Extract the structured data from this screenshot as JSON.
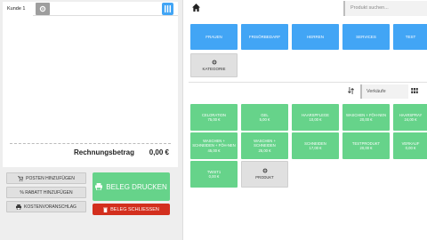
{
  "tabs": {
    "active": "Kunde 1"
  },
  "receipt": {
    "total_label": "Rechnungsbetrag",
    "total_value": "0,00 €"
  },
  "actions": {
    "add_item": "POSTEN HINZUFÜGEN",
    "add_discount": "% RABATT HINZUFÜGEN",
    "estimate": "KOSTENVORANSCHLAG",
    "print": "BELEG DRUCKEN",
    "close": "BELEG SCHLIESSEN"
  },
  "search": {
    "placeholder": "Produkt suchen..."
  },
  "categories": [
    "FRAUEN",
    "FRISÖRBEDARF",
    "HERREN",
    "SERVICES",
    "TEST"
  ],
  "category_button": "KATEGORIE",
  "sort": {
    "selected": "Verkäufe"
  },
  "products": [
    {
      "name": "CELORATION",
      "price": "75,00 €"
    },
    {
      "name": "GEL",
      "price": "5,00 €"
    },
    {
      "name": "HAARSPFLEGE",
      "price": "10,00 €"
    },
    {
      "name": "WASCHEN + FÖH-NEN",
      "price": "20,00 €"
    },
    {
      "name": "HAARSPRAY",
      "price": "24,00 €"
    },
    {
      "name": "WASCHEN + SCHNEIDEN + FÖH-NEN",
      "price": "45,00 €"
    },
    {
      "name": "WASCHEN + SCHNEIDEN",
      "price": "25,00 €"
    },
    {
      "name": "SCHNEIDEN",
      "price": "17,00 €"
    },
    {
      "name": "TESTPRODUKT",
      "price": "20,00 €"
    },
    {
      "name": "VERKAUF",
      "price": "0,00 €"
    },
    {
      "name": "TWIST1",
      "price": "0,00 €"
    }
  ],
  "product_button": "PRODUKT",
  "colors": {
    "blue": "#42a5f5",
    "green": "#66d38a",
    "red": "#d32f1e",
    "grey": "#e0e0e0"
  }
}
